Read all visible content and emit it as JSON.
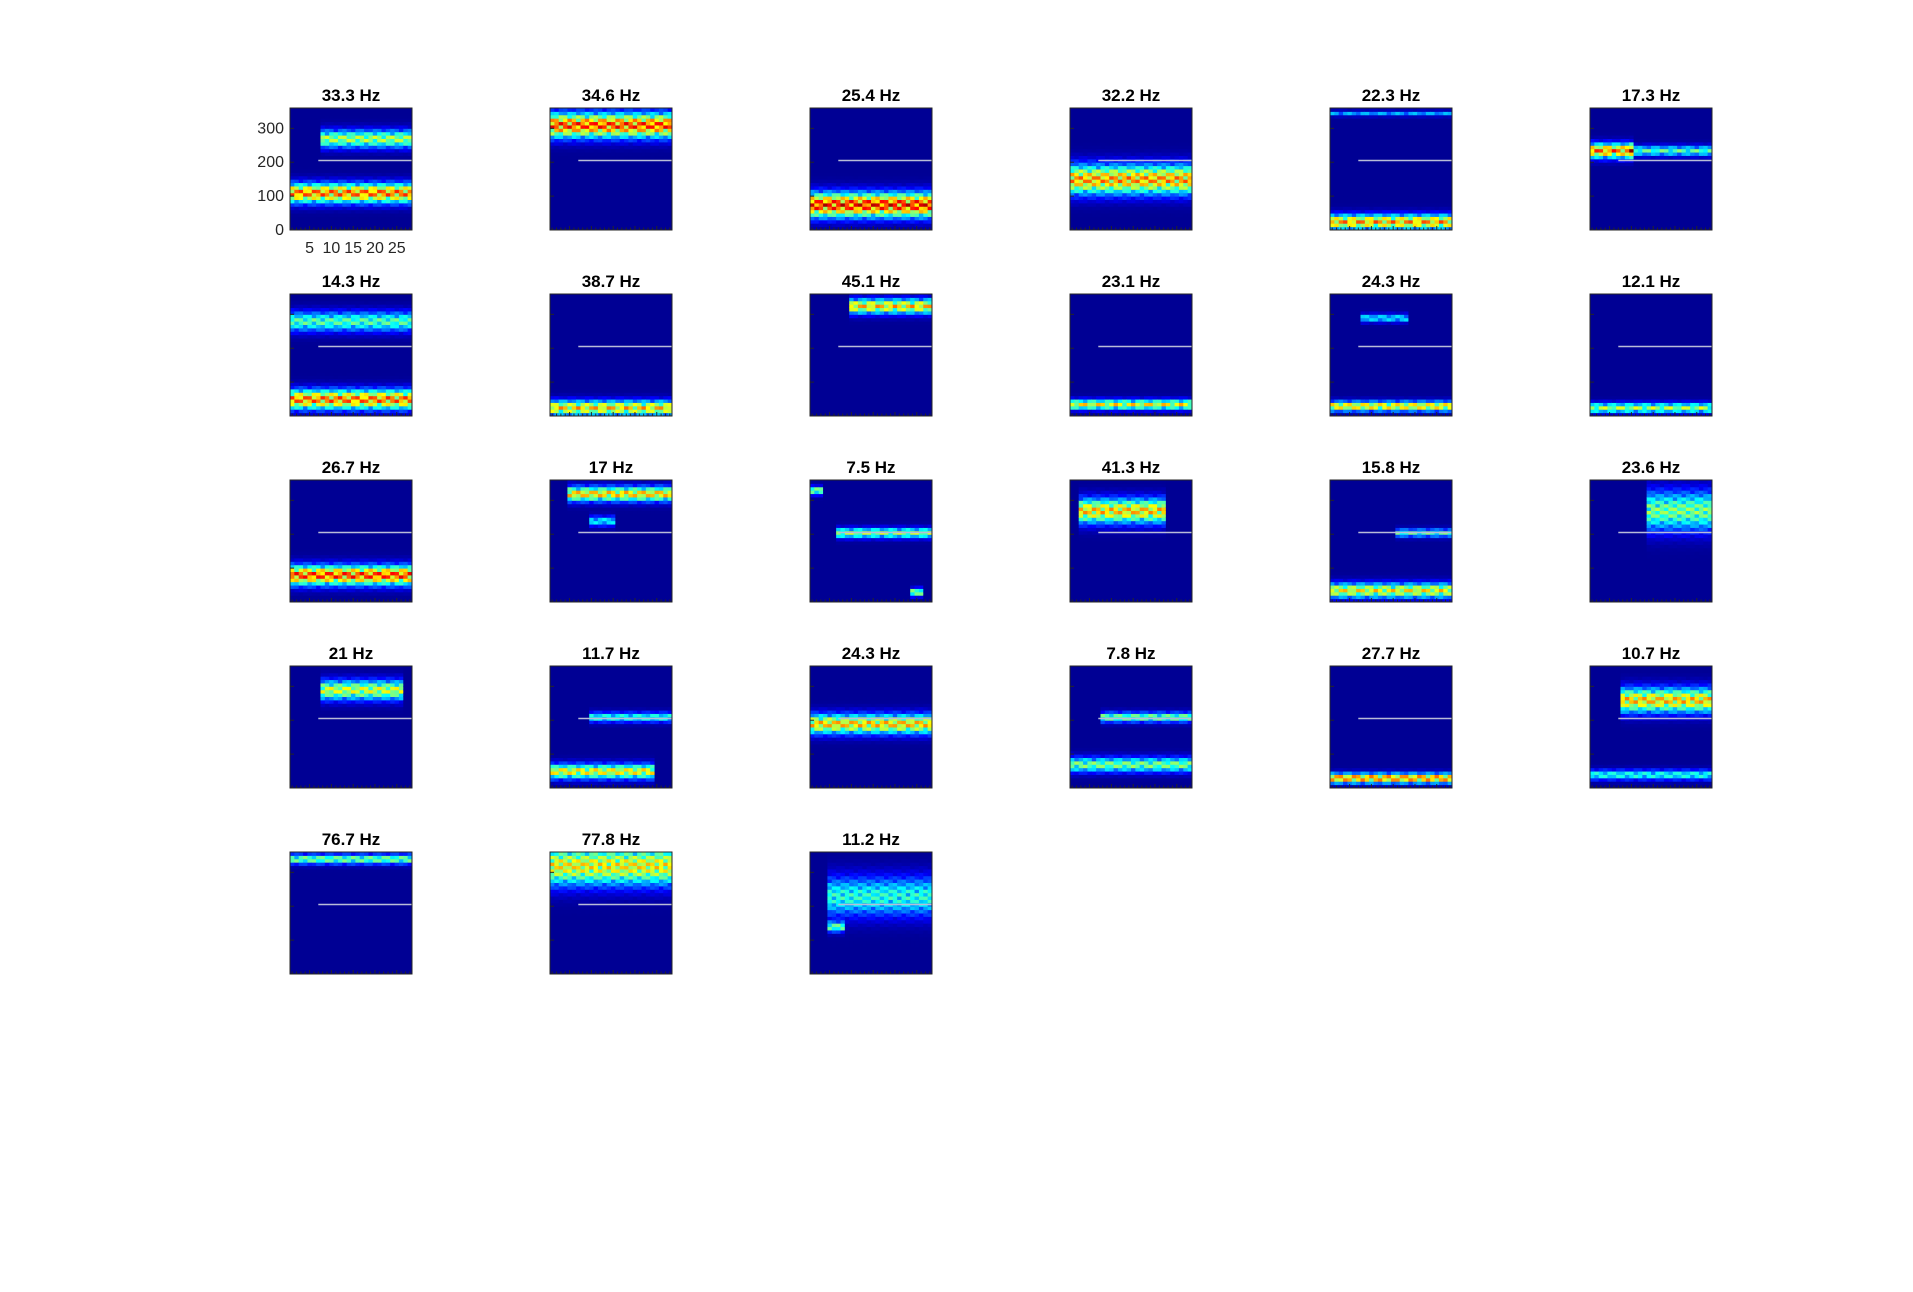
{
  "chart_data": {
    "type": "heatmap",
    "colormap": "jet",
    "layout": {
      "rows": 5,
      "cols": 6
    },
    "x_ticks": [
      5,
      10,
      15,
      20,
      25
    ],
    "y_ticks": [
      0,
      100,
      200,
      300
    ],
    "x_range": [
      1,
      28
    ],
    "y_range": [
      0,
      360
    ],
    "reference_line_y": 205,
    "tick_labels_shown_on_first_panel_only": true,
    "panels": [
      {
        "title": "33.3 Hz",
        "blobs": [
          [
            1,
            28,
            110,
            20,
            0.85
          ],
          [
            8,
            28,
            270,
            18,
            0.6
          ]
        ]
      },
      {
        "title": "34.6 Hz",
        "blobs": [
          [
            1,
            28,
            310,
            25,
            0.9
          ]
        ]
      },
      {
        "title": "25.4 Hz",
        "blobs": [
          [
            1,
            28,
            75,
            25,
            0.95
          ]
        ]
      },
      {
        "title": "32.2 Hz",
        "blobs": [
          [
            1,
            28,
            150,
            30,
            0.8
          ]
        ]
      },
      {
        "title": "22.3 Hz",
        "blobs": [
          [
            1,
            28,
            25,
            15,
            0.8
          ],
          [
            1,
            28,
            345,
            5,
            0.3
          ]
        ]
      },
      {
        "title": "17.3 Hz",
        "blobs": [
          [
            1,
            10,
            235,
            15,
            0.85
          ],
          [
            10,
            28,
            235,
            10,
            0.5
          ]
        ]
      },
      {
        "title": "14.3 Hz",
        "blobs": [
          [
            1,
            28,
            50,
            20,
            0.85
          ],
          [
            1,
            28,
            280,
            20,
            0.5
          ]
        ]
      },
      {
        "title": "38.7 Hz",
        "blobs": [
          [
            1,
            28,
            25,
            15,
            0.75
          ]
        ]
      },
      {
        "title": "45.1 Hz",
        "blobs": [
          [
            10,
            28,
            325,
            15,
            0.75
          ]
        ]
      },
      {
        "title": "23.1 Hz",
        "blobs": [
          [
            1,
            28,
            35,
            10,
            0.7
          ]
        ]
      },
      {
        "title": "24.3 Hz",
        "blobs": [
          [
            1,
            28,
            30,
            10,
            0.75
          ],
          [
            8,
            18,
            290,
            8,
            0.4
          ]
        ]
      },
      {
        "title": "12.1 Hz",
        "blobs": [
          [
            1,
            28,
            25,
            10,
            0.6
          ]
        ]
      },
      {
        "title": "26.7 Hz",
        "blobs": [
          [
            1,
            28,
            80,
            20,
            0.9
          ]
        ]
      },
      {
        "title": "17 Hz",
        "blobs": [
          [
            5,
            28,
            320,
            15,
            0.75
          ],
          [
            10,
            15,
            240,
            10,
            0.4
          ]
        ]
      },
      {
        "title": "7.5 Hz",
        "blobs": [
          [
            7,
            28,
            205,
            10,
            0.6
          ],
          [
            1,
            3,
            330,
            8,
            0.6
          ],
          [
            24,
            26,
            30,
            8,
            0.6
          ]
        ]
      },
      {
        "title": "41.3 Hz",
        "blobs": [
          [
            3,
            22,
            270,
            25,
            0.75
          ]
        ]
      },
      {
        "title": "15.8 Hz",
        "blobs": [
          [
            1,
            28,
            35,
            15,
            0.7
          ],
          [
            16,
            28,
            205,
            8,
            0.5
          ]
        ]
      },
      {
        "title": "23.6 Hz",
        "blobs": [
          [
            14,
            28,
            270,
            40,
            0.55
          ]
        ]
      },
      {
        "title": "21 Hz",
        "blobs": [
          [
            8,
            26,
            290,
            20,
            0.65
          ]
        ]
      },
      {
        "title": "11.7 Hz",
        "blobs": [
          [
            1,
            24,
            50,
            15,
            0.7
          ],
          [
            10,
            28,
            210,
            10,
            0.45
          ]
        ]
      },
      {
        "title": "24.3 Hz",
        "blobs": [
          [
            1,
            28,
            190,
            20,
            0.75
          ]
        ]
      },
      {
        "title": "7.8 Hz",
        "blobs": [
          [
            1,
            28,
            70,
            15,
            0.55
          ],
          [
            8,
            28,
            210,
            10,
            0.55
          ]
        ]
      },
      {
        "title": "27.7 Hz",
        "blobs": [
          [
            1,
            28,
            30,
            10,
            0.85
          ]
        ]
      },
      {
        "title": "10.7 Hz",
        "blobs": [
          [
            8,
            28,
            260,
            25,
            0.75
          ],
          [
            1,
            28,
            40,
            10,
            0.45
          ]
        ]
      },
      {
        "title": "76.7 Hz",
        "blobs": [
          [
            1,
            28,
            340,
            10,
            0.55
          ]
        ]
      },
      {
        "title": "77.8 Hz",
        "blobs": [
          [
            1,
            28,
            320,
            40,
            0.7
          ]
        ]
      },
      {
        "title": "11.2 Hz",
        "blobs": [
          [
            5,
            28,
            230,
            40,
            0.45
          ],
          [
            5,
            8,
            140,
            10,
            0.5
          ]
        ]
      }
    ]
  }
}
